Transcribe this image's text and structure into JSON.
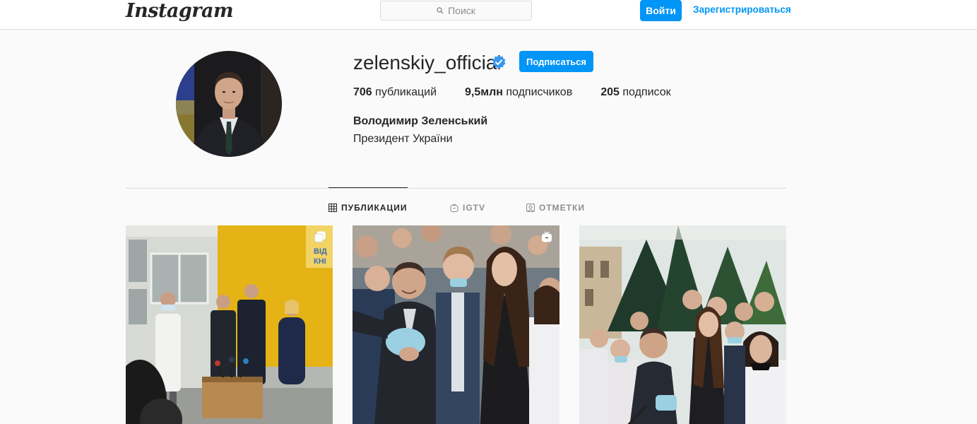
{
  "header": {
    "logo": "Instagram",
    "search_placeholder": "Поиск",
    "login_label": "Войти",
    "signup_label": "Зарегистрироваться"
  },
  "profile": {
    "username": "zelenskiy_official",
    "follow_label": "Подписаться",
    "stats": {
      "posts_count": "706",
      "posts_label": "публикаций",
      "followers_count": "9,5млн",
      "followers_label": "подписчиков",
      "following_count": "205",
      "following_label": "подписок"
    },
    "full_name": "Володимир Зеленський",
    "bio": "Президент України"
  },
  "tabs": [
    {
      "label": "ПУБЛИКАЦИИ",
      "icon": "grid-icon",
      "active": true
    },
    {
      "label": "IGTV",
      "icon": "igtv-icon",
      "active": false
    },
    {
      "label": "ОТМЕТКИ",
      "icon": "tagged-icon",
      "active": false
    }
  ],
  "posts": [
    {
      "badge_icon": "multi-photo-icon",
      "sign_text": "ВІД КНІ"
    },
    {
      "badge_icon": "igtv-icon"
    },
    {
      "badge_icon": "none"
    }
  ],
  "colors": {
    "accent": "#0095f6",
    "text": "#262626",
    "secondary": "#8e8e8e",
    "background": "#fafafa",
    "border": "#dbdbdb"
  }
}
